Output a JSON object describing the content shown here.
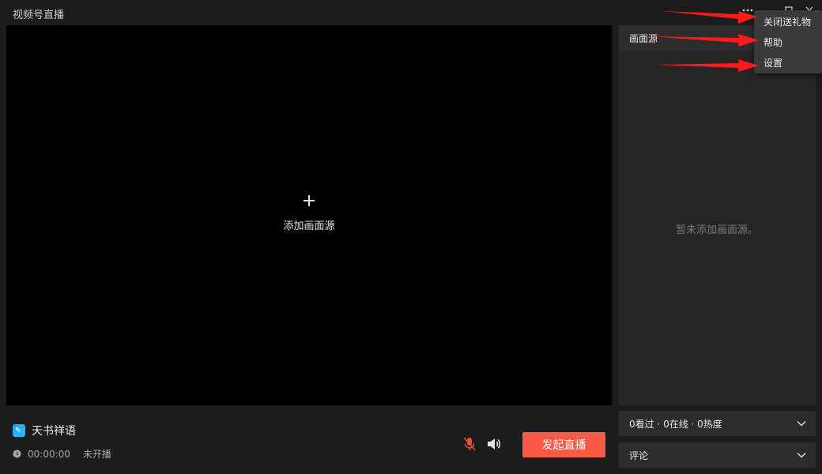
{
  "window": {
    "title": "视频号直播",
    "controls": [
      "more-icon",
      "minimize-icon",
      "maximize-icon",
      "close-icon"
    ]
  },
  "preview": {
    "add_source_label": "添加画面源"
  },
  "source_panel": {
    "header": "画面源",
    "empty_text": "暂未添加画面源。"
  },
  "stats": {
    "label": "0看过 · 0在线 · 0热度"
  },
  "comments": {
    "label": "评论"
  },
  "channel": {
    "name": "天书祥语",
    "duration": "00:00:00",
    "status": "未开播"
  },
  "controls": {
    "mic_state": "muted",
    "start_label": "发起直播"
  },
  "menu": {
    "items": [
      "关闭送礼物",
      "帮助",
      "设置"
    ]
  },
  "colors": {
    "accent": "#fa5a45",
    "annotation_arrow": "#ff1a1a",
    "background": "#1c1c1c",
    "preview": "#000000",
    "panel": "#252525"
  }
}
